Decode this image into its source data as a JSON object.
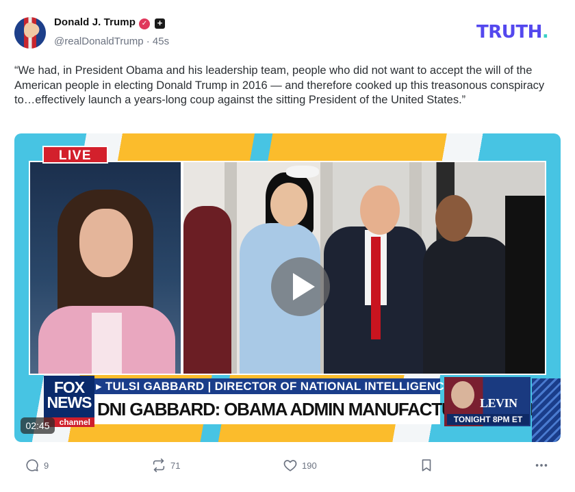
{
  "author": {
    "name": "Donald J. Trump",
    "handle": "@realDonaldTrump",
    "separator": "·",
    "time_ago": "45s",
    "verified_badge_icon": "verified-check-icon",
    "plus_badge": "+"
  },
  "brand": {
    "logo_text": "TRUTH",
    "logo_dot": ".",
    "logo_color": "#5448ee",
    "dot_color": "#39d0c7"
  },
  "post": {
    "text": "“We had, in President Obama and his leadership team, people who did not want to accept the will of the American people in electing Donald Trump in 2016 — and therefore cooked up this treasonous conspiracy to…effectively launch a years-long coup against the sitting President of the United States.”"
  },
  "video": {
    "duration": "02:45",
    "live_label": "LIVE",
    "ticker_top": "▸ TULSI GABBARD | DIRECTOR OF NATIONAL INTELLIGENCE",
    "ticker_main": "DNI GABBARD: OBAMA ADMIN MANUFACTURED INTELLIGENCE",
    "network_logo": "FOX\nNEWS",
    "network_sub": "channel",
    "promo_show": "LEVIN",
    "promo_time": "TONIGHT 8PM ET"
  },
  "actions": {
    "replies": "9",
    "retruths": "71",
    "likes": "190"
  }
}
